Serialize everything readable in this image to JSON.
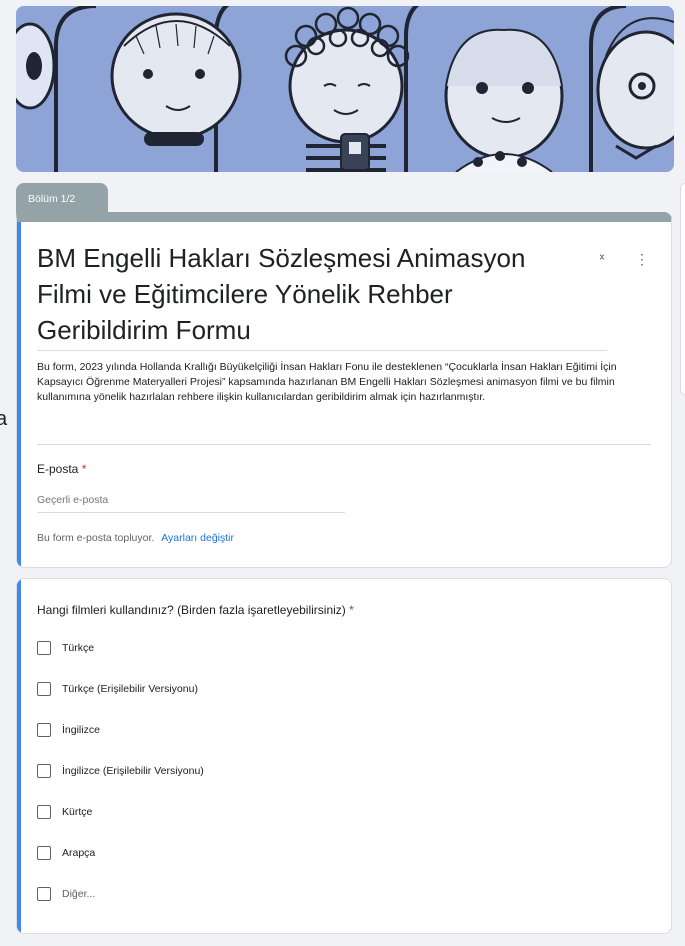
{
  "section": {
    "tab_label": "Bölüm 1/2"
  },
  "form": {
    "title": "BM Engelli Hakları Sözleşmesi Animasyon Filmi ve  Eğitimcilere Yönelik Rehber Geribildirim Formu",
    "description": "Bu form, 2023 yılında Hollanda Krallığı Büyükelçiliği İnsan Hakları Fonu ile desteklenen “Çocuklarla İnsan Hakları Eğitimi İçin Kapsayıcı Öğrenme Materyalleri Projesi” kapsamında hazırlanan BM Engelli Hakları Sözleşmesi animasyon filmi ve bu filmin kullanımına yönelik hazırlalan rehbere ilişkin kullanıcılardan geribildirim almak için hazırlanmıştır.",
    "collapse_icon": "collapse-icon",
    "more_icon": "more-vert-icon"
  },
  "email": {
    "label": "E-posta",
    "required_mark": "*",
    "placeholder": "Geçerli e-posta",
    "value": "",
    "collect_note": "Bu form e-posta topluyor.",
    "settings_link": "Ayarları değiştir"
  },
  "question": {
    "title": "Hangi filmleri kullandınız? (Birden fazla işaretleyebilirsiniz)",
    "required_mark": "*",
    "options": [
      {
        "label": "Türkçe",
        "checked": false
      },
      {
        "label": "Türkçe (Erişilebilir Versiyonu)",
        "checked": false
      },
      {
        "label": "İngilizce",
        "checked": false
      },
      {
        "label": "İngilizce (Erişilebilir  Versiyonu)",
        "checked": false
      },
      {
        "label": "Kürtçe",
        "checked": false
      },
      {
        "label": "Arapça",
        "checked": false
      },
      {
        "label": "Diğer...",
        "checked": false
      }
    ]
  },
  "left_stub": "a",
  "colors": {
    "accent_blue": "#4285f4",
    "section_gray": "#94a3a8",
    "required_red": "#d93025",
    "link_blue": "#1a73e8",
    "banner_blue": "#8ea3d6"
  }
}
